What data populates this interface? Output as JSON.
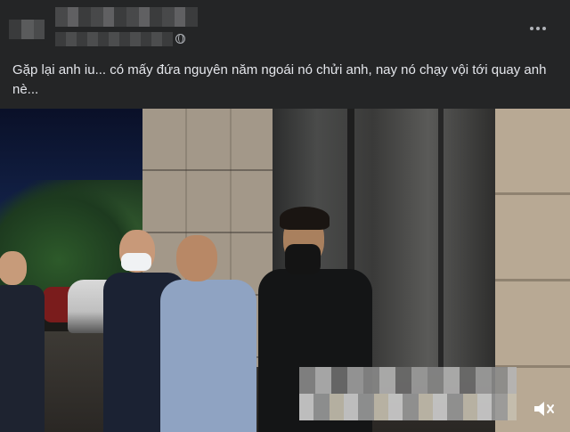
{
  "post": {
    "text": "Gặp lại anh iu... có mấy đứa nguyên năm ngoái nó chửi anh, nay nó chạy vội tới quay anh nè...",
    "privacy_icon": "globe-icon",
    "menu_icon": "more-icon"
  },
  "video": {
    "controls": {
      "volume_icon": "volume-muted-icon"
    }
  },
  "colors": {
    "background": "#242526",
    "text": "#e4e6eb",
    "secondary": "#b0b3b8"
  }
}
